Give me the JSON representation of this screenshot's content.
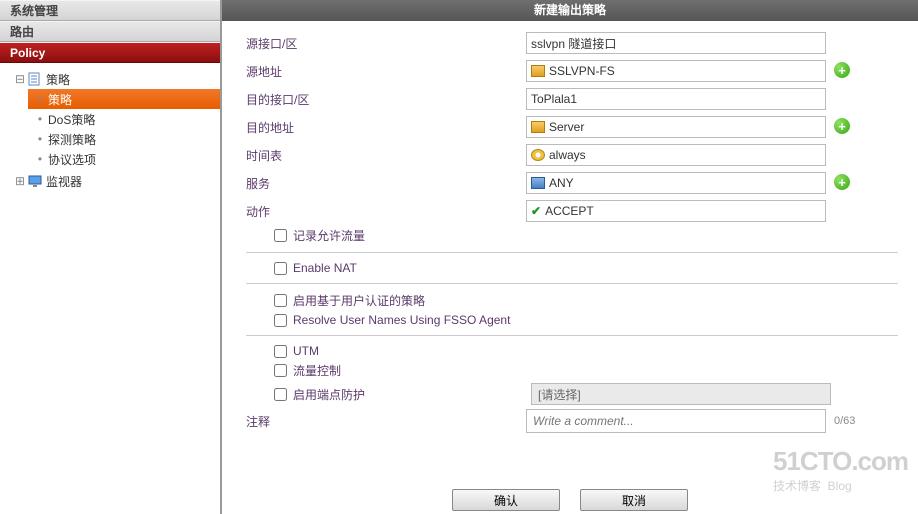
{
  "sidebar": {
    "groups": [
      {
        "label": "系统管理",
        "active": false
      },
      {
        "label": "路由",
        "active": false
      },
      {
        "label": "Policy",
        "active": true
      }
    ],
    "tree": {
      "root": "策略",
      "children": [
        {
          "label": "策略",
          "selected": true
        },
        {
          "label": "DoS策略",
          "selected": false
        },
        {
          "label": "探测策略",
          "selected": false
        },
        {
          "label": "协议选项",
          "selected": false
        }
      ],
      "root2": "监视器"
    }
  },
  "title": "新建输出策略",
  "fields": {
    "src_if_label": "源接口/区",
    "src_if_value": "sslvpn 隧道接口",
    "src_addr_label": "源地址",
    "src_addr_value": "SSLVPN-FS",
    "dst_if_label": "目的接口/区",
    "dst_if_value": "ToPlala1",
    "dst_addr_label": "目的地址",
    "dst_addr_value": "Server",
    "sched_label": "时间表",
    "sched_value": "always",
    "svc_label": "服务",
    "svc_value": "ANY",
    "action_label": "动作",
    "action_value": "ACCEPT"
  },
  "checks": {
    "log": "记录允许流量",
    "nat": "Enable NAT",
    "ident": "启用基于用户认证的策略",
    "fsso": "Resolve User Names Using FSSO Agent",
    "utm": "UTM",
    "traffic": "流量控制",
    "endpoint": "启用端点防护",
    "endpoint_hint": "[请选择]"
  },
  "comment": {
    "label": "注释",
    "placeholder": "Write a comment...",
    "counter": "0/63"
  },
  "buttons": {
    "ok": "确认",
    "cancel": "取消"
  },
  "watermark": {
    "main": "51CTO.com",
    "sub1": "技术博客",
    "sub2": "Blog"
  }
}
